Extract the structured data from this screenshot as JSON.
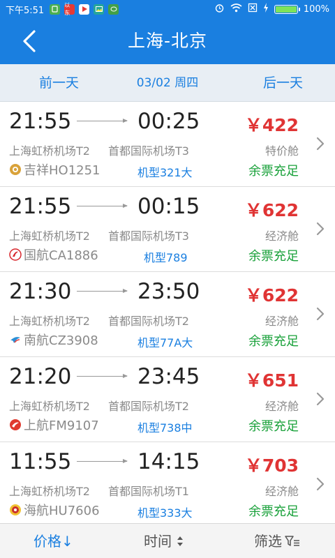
{
  "status_bar": {
    "time": "下午5:51",
    "app_badge": "以东",
    "battery": "100%",
    "battery_level": 1.0
  },
  "header": {
    "title": "上海-北京"
  },
  "date_bar": {
    "prev": "前一天",
    "current": "03/02 周四",
    "next": "后一天"
  },
  "flights": [
    {
      "dep_time": "21:55",
      "arr_time": "00:25",
      "price": "￥422",
      "dep_airport": "上海虹桥机场T2",
      "arr_airport": "首都国际机场T3",
      "cabin": "特价舱",
      "airline": "吉祥HO1251",
      "aircraft": "机型321大",
      "availability": "余票充足",
      "logo": "juneyao-logo",
      "logo_color": "#d9a23a"
    },
    {
      "dep_time": "21:55",
      "arr_time": "00:15",
      "price": "￥622",
      "dep_airport": "上海虹桥机场T2",
      "arr_airport": "首都国际机场T3",
      "cabin": "经济舱",
      "airline": "国航CA1886",
      "aircraft": "机型789",
      "availability": "余票充足",
      "logo": "air-china-logo",
      "logo_color": "#d8262c"
    },
    {
      "dep_time": "21:30",
      "arr_time": "23:50",
      "price": "￥622",
      "dep_airport": "上海虹桥机场T2",
      "arr_airport": "首都国际机场T2",
      "cabin": "经济舱",
      "airline": "南航CZ3908",
      "aircraft": "机型77A大",
      "availability": "余票充足",
      "logo": "china-southern-logo",
      "logo_color": "#2b8fd6"
    },
    {
      "dep_time": "21:20",
      "arr_time": "23:45",
      "price": "￥651",
      "dep_airport": "上海虹桥机场T2",
      "arr_airport": "首都国际机场T2",
      "cabin": "经济舱",
      "airline": "上航FM9107",
      "aircraft": "机型738中",
      "availability": "余票充足",
      "logo": "shanghai-airlines-logo",
      "logo_color": "#e03a2f"
    },
    {
      "dep_time": "11:55",
      "arr_time": "14:15",
      "price": "￥703",
      "dep_airport": "上海虹桥机场T2",
      "arr_airport": "首都国际机场T1",
      "cabin": "经济舱",
      "airline": "海航HU7606",
      "aircraft": "机型333大",
      "availability": "余票充足",
      "logo": "hainan-airlines-logo",
      "logo_color": "#c9302c"
    }
  ],
  "bottom_bar": {
    "price_sort": "价格↓",
    "time_sort": "时间",
    "filter": "筛选"
  },
  "colors": {
    "primary": "#1a7fe0",
    "price": "#e03434",
    "availability": "#19a13a"
  }
}
